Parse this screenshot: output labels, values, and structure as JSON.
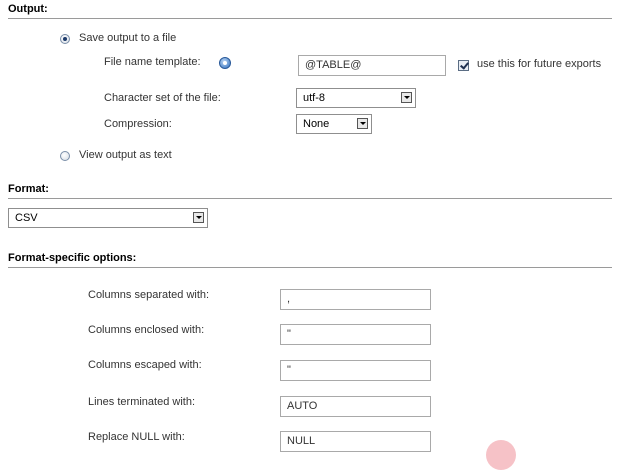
{
  "output": {
    "heading": "Output:",
    "save_option_label": "Save output to a file",
    "file_name_label": "File name template:",
    "file_name_value": "@TABLE@",
    "future_exports_label": "use this for future exports",
    "future_exports_checked": true,
    "charset_label": "Character set of the file:",
    "charset_value": "utf-8",
    "compression_label": "Compression:",
    "compression_value": "None",
    "view_option_label": "View output as text",
    "save_selected": true
  },
  "format": {
    "heading": "Format:",
    "value": "CSV"
  },
  "format_options": {
    "heading": "Format-specific options:",
    "fields": [
      {
        "label": "Columns separated with:",
        "value": ","
      },
      {
        "label": "Columns enclosed with:",
        "value": "\""
      },
      {
        "label": "Columns escaped with:",
        "value": "\""
      },
      {
        "label": "Lines terminated with:",
        "value": "AUTO"
      },
      {
        "label": "Replace NULL with:",
        "value": "NULL"
      }
    ]
  },
  "icons": {
    "help": "info-help-icon",
    "radio": "radio-icon",
    "checkbox": "checkbox-icon",
    "dropdown": "dropdown-arrow-icon"
  },
  "colors": {
    "rule": "#9a9a9a",
    "help_icon": "#2f6fbd",
    "cursor_marker": "#f5b7bd"
  }
}
